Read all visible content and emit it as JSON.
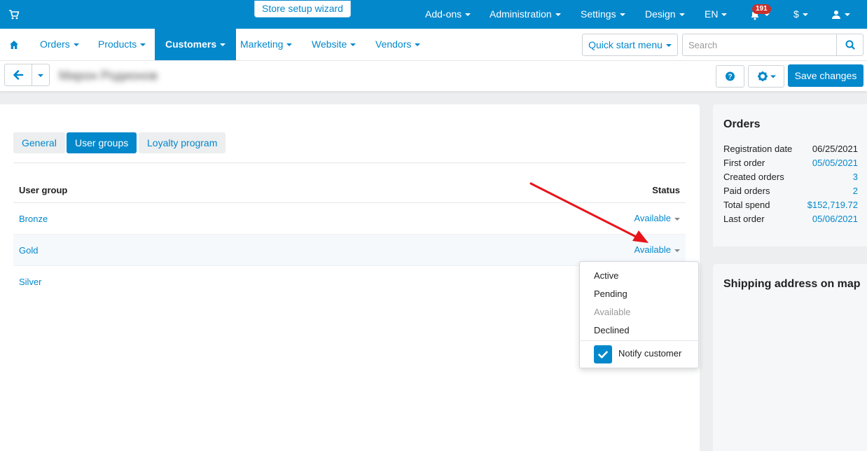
{
  "topbar": {
    "wizard": "Store setup wizard",
    "addons": "Add-ons",
    "administration": "Administration",
    "settings": "Settings",
    "design": "Design",
    "language": "EN",
    "notifications_count": "191",
    "currency": "$"
  },
  "nav": {
    "orders": "Orders",
    "products": "Products",
    "customers": "Customers",
    "marketing": "Marketing",
    "website": "Website",
    "vendors": "Vendors",
    "quick_start": "Quick start menu",
    "search_placeholder": "Search"
  },
  "toolbar": {
    "title": "Мирон Родионов",
    "save": "Save changes"
  },
  "tabs": {
    "general": "General",
    "user_groups": "User groups",
    "loyalty": "Loyalty program"
  },
  "table": {
    "col_group": "User group",
    "col_status": "Status",
    "rows": [
      {
        "name": "Bronze",
        "status": "Available"
      },
      {
        "name": "Gold",
        "status": "Available"
      },
      {
        "name": "Silver",
        "status": ""
      }
    ]
  },
  "dropdown": {
    "options": [
      "Active",
      "Pending",
      "Available",
      "Declined"
    ],
    "notify": "Notify customer",
    "notify_checked": true
  },
  "sidebar": {
    "orders_title": "Orders",
    "stats": [
      {
        "label": "Registration date",
        "value": "06/25/2021"
      },
      {
        "label": "First order",
        "value": "05/05/2021"
      },
      {
        "label": "Created orders",
        "value": "3"
      },
      {
        "label": "Paid orders",
        "value": "2"
      },
      {
        "label": "Total spend",
        "value": "$152,719.72"
      },
      {
        "label": "Last order",
        "value": "05/06/2021"
      }
    ],
    "map_title": "Shipping address on map"
  },
  "colors": {
    "brand": "#0388cc",
    "annotation_arrow": "#e8141a"
  }
}
